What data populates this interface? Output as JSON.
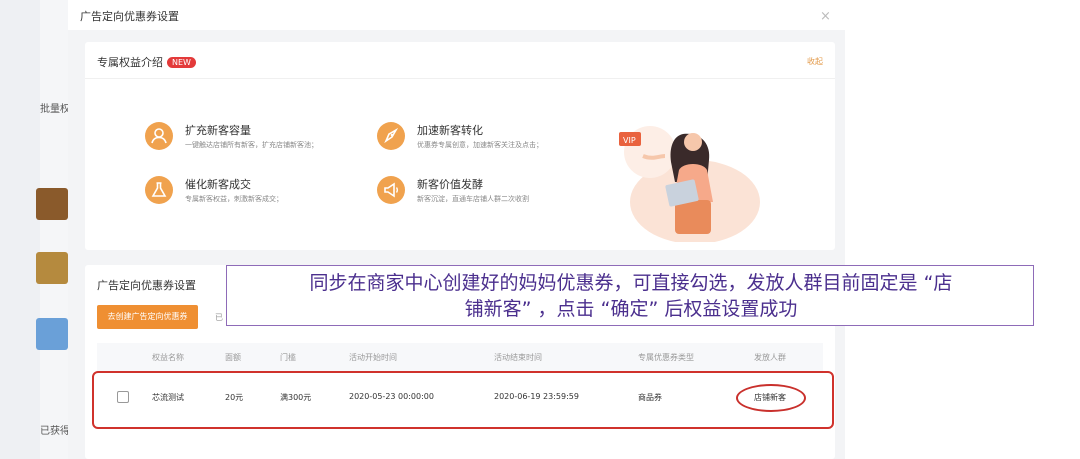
{
  "modal": {
    "title": "广告定向优惠券设置",
    "close_glyph": "×"
  },
  "background": {
    "label_1": "批量权",
    "label_2": "已获得"
  },
  "intro": {
    "title": "专属权益介绍",
    "badge": "NEW",
    "collapse": "收起",
    "features": [
      {
        "icon": "user-plus-icon",
        "title": "扩充新客容量",
        "desc": "一键触达店铺所有新客，扩充店铺新客池；"
      },
      {
        "icon": "rocket-icon",
        "title": "加速新客转化",
        "desc": "优惠券专属创意，加速新客关注及点击；"
      },
      {
        "icon": "flask-icon",
        "title": "催化新客成交",
        "desc": "专属新客权益，刺激新客成交；"
      },
      {
        "icon": "megaphone-icon",
        "title": "新客价值发酵",
        "desc": "新客沉淀，直通车店铺人群二次收割"
      }
    ]
  },
  "coupon": {
    "title": "广告定向优惠券设置",
    "create_button": "去创建广告定向优惠券",
    "hint": "已",
    "columns": [
      "权益名称",
      "面额",
      "门槛",
      "活动开始时间",
      "活动结束时间",
      "专属优惠券类型",
      "发放人群"
    ],
    "rows": [
      {
        "name": "芯流测试",
        "amount": "20元",
        "threshold": "满300元",
        "start": "2020-05-23 00:00:00",
        "end": "2020-06-19 23:59:59",
        "type": "商品券",
        "audience": "店铺新客"
      }
    ]
  },
  "annotation": {
    "line1": "同步在商家中心创建好的妈妈优惠券，可直接勾选，发放人群目前固定是 “店",
    "line2": "铺新客” ，点击 “确定” 后权益设置成功"
  },
  "colors": {
    "accent": "#ef8f32",
    "badge": "#e33a3a",
    "highlight": "#d0322c",
    "annotation": "#4b2f8e"
  }
}
